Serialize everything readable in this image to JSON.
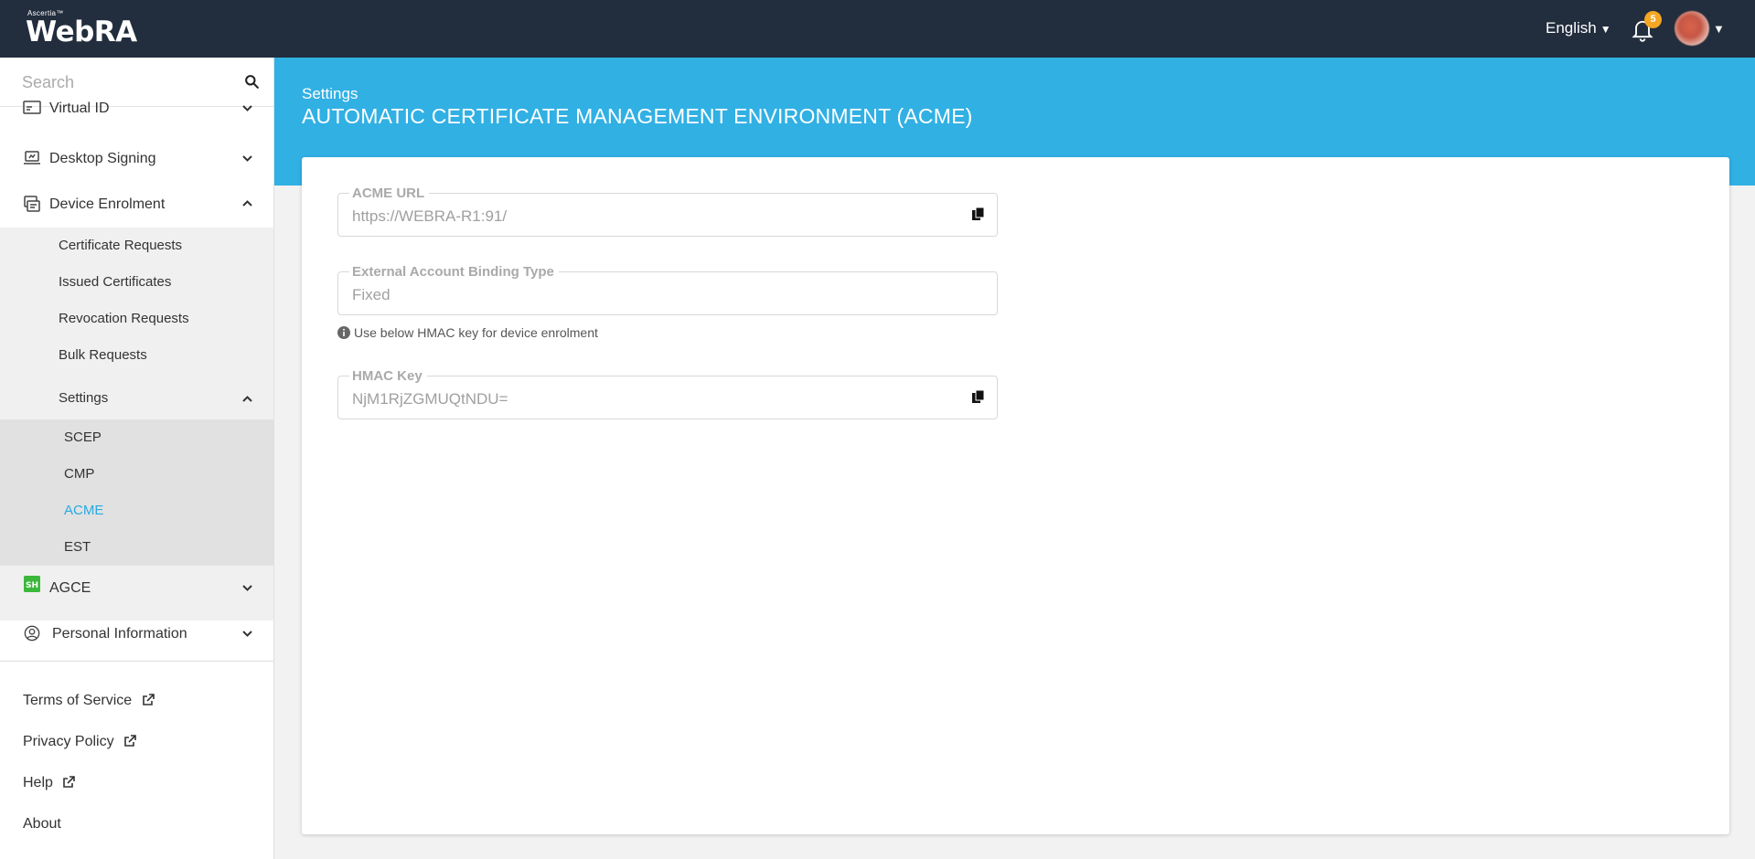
{
  "topbar": {
    "brand_small": "Ascertia™",
    "brand": "WebRA",
    "language": "English",
    "notification_count": "5"
  },
  "sidebar": {
    "search_placeholder": "Search",
    "items": [
      {
        "label": "Virtual ID",
        "icon": "virtual-id-icon",
        "expanded": false
      },
      {
        "label": "Desktop Signing",
        "icon": "desktop-signing-icon",
        "expanded": false
      },
      {
        "label": "Device Enrolment",
        "icon": "device-enrolment-icon",
        "expanded": true
      },
      {
        "label": "AGCE",
        "icon": "agce-icon",
        "expanded": false
      },
      {
        "label": "Personal Information",
        "icon": "user-circle-icon",
        "expanded": false
      }
    ],
    "device_enrolment_children": [
      {
        "label": "Certificate Requests"
      },
      {
        "label": "Issued Certificates"
      },
      {
        "label": "Revocation Requests"
      },
      {
        "label": "Bulk Requests"
      },
      {
        "label": "Settings",
        "expanded": true
      }
    ],
    "settings_children": [
      {
        "label": "SCEP",
        "active": false
      },
      {
        "label": "CMP",
        "active": false
      },
      {
        "label": "ACME",
        "active": true
      },
      {
        "label": "EST",
        "active": false
      }
    ],
    "footer_links": [
      {
        "label": "Terms of Service",
        "external": true
      },
      {
        "label": "Privacy Policy",
        "external": true
      },
      {
        "label": "Help",
        "external": true
      },
      {
        "label": "About",
        "external": false
      }
    ]
  },
  "main": {
    "breadcrumb": "Settings",
    "title": "AUTOMATIC CERTIFICATE MANAGEMENT ENVIRONMENT (ACME)",
    "fields": [
      {
        "label": "ACME URL",
        "value": "https://WEBRA-R1:91/",
        "copyable": true
      },
      {
        "label": "External Account Binding Type",
        "value": "Fixed",
        "copyable": false
      },
      {
        "label": "HMAC Key",
        "value": "NjM1RjZGMUQtNDU=",
        "copyable": true
      }
    ],
    "hint": "Use below HMAC key for device enrolment"
  },
  "colors": {
    "topbar": "#222d3d",
    "accent": "#31b0e4",
    "active_link": "#2aa9e0",
    "badge": "#f5a623",
    "agce_icon": "#3bb83b"
  }
}
